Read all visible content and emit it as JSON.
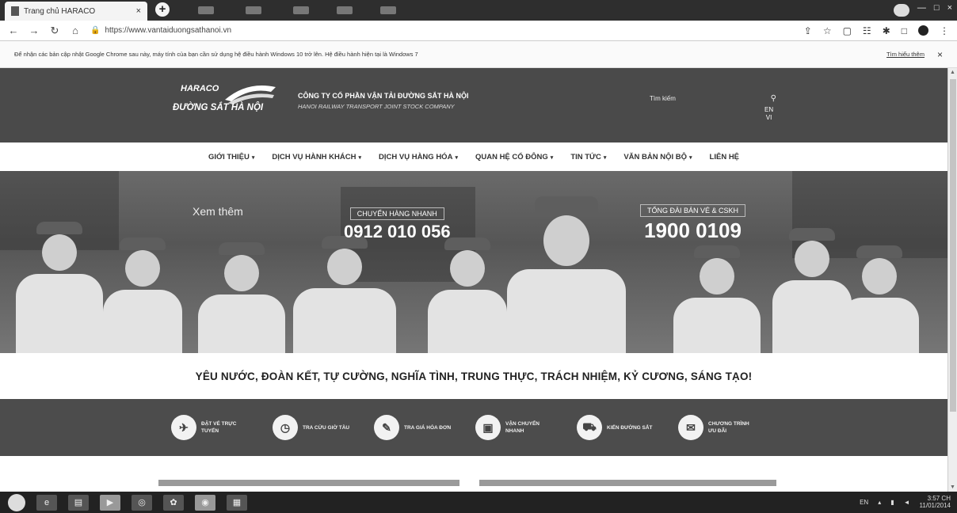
{
  "browser": {
    "tab_title": "Trang chủ HARACO",
    "tab_close": "×",
    "new_tab": "+",
    "url": "https://www.vantaiduongsathanoi.vn",
    "window_controls": [
      "—",
      "□",
      "×"
    ]
  },
  "infobar": {
    "message": "Để nhận các bản cập nhật Google Chrome sau này, máy tính của bạn cần sử dụng hệ điều hành Windows 10 trở lên. Hệ điều hành hiện tại là Windows 7",
    "more": "Tìm hiểu thêm",
    "close": "×"
  },
  "header": {
    "brand_top": "HARACO",
    "brand_bottom": "ĐƯỜNG SẮT HÀ NỘI",
    "company_vn": "CÔNG TY CỔ PHẦN VẬN TẢI ĐƯỜNG SẮT HÀ NỘI",
    "company_en": "HANOI RAILWAY TRANSPORT JOINT STOCK COMPANY",
    "search_placeholder": "Tìm kiếm",
    "lang_en": "EN",
    "lang_vi": "VI"
  },
  "nav": [
    {
      "label": "GIỚI THIỆU",
      "caret": "▾"
    },
    {
      "label": "DỊCH VỤ HÀNH KHÁCH",
      "caret": "▾"
    },
    {
      "label": "DỊCH VỤ HÀNG HÓA",
      "caret": "▾"
    },
    {
      "label": "QUAN HỆ CỔ ĐÔNG",
      "caret": "▾"
    },
    {
      "label": "TIN TỨC",
      "caret": "▾"
    },
    {
      "label": "VĂN BẢN NỘI BỘ",
      "caret": "▾"
    },
    {
      "label": "LIÊN HỆ",
      "caret": ""
    }
  ],
  "hero": {
    "xem_them": "Xem thêm",
    "hotline1_label": "CHUYỂN HÀNG NHANH",
    "hotline1_number": "0912 010 056",
    "hotline2_label": "TỔNG ĐÀI BÁN VÉ & CSKH",
    "hotline2_number": "1900 0109"
  },
  "slogan": "YÊU NƯỚC, ĐOÀN KẾT, TỰ CƯỜNG, NGHĨA TÌNH, TRUNG THỰC, TRÁCH NHIỆM, KỶ CƯƠNG, SÁNG TẠO!",
  "services": [
    {
      "label": "ĐẶT VÉ TRỰC TUYẾN",
      "icon": "ticket-icon"
    },
    {
      "label": "TRA CỨU GIỜ TÀU",
      "icon": "clock-icon"
    },
    {
      "label": "TRA GIÁ HÓA ĐƠN",
      "icon": "invoice-icon"
    },
    {
      "label": "VẬN CHUYỂN NHANH",
      "icon": "box-icon"
    },
    {
      "label": "KIẾN ĐƯỜNG SẮT",
      "icon": "train-icon"
    },
    {
      "label": "CHƯƠNG TRÌNH ƯU ĐÃI",
      "icon": "gift-icon"
    }
  ],
  "taskbar": {
    "lang": "EN",
    "time": "3:57 CH",
    "date": "11/01/2014"
  }
}
